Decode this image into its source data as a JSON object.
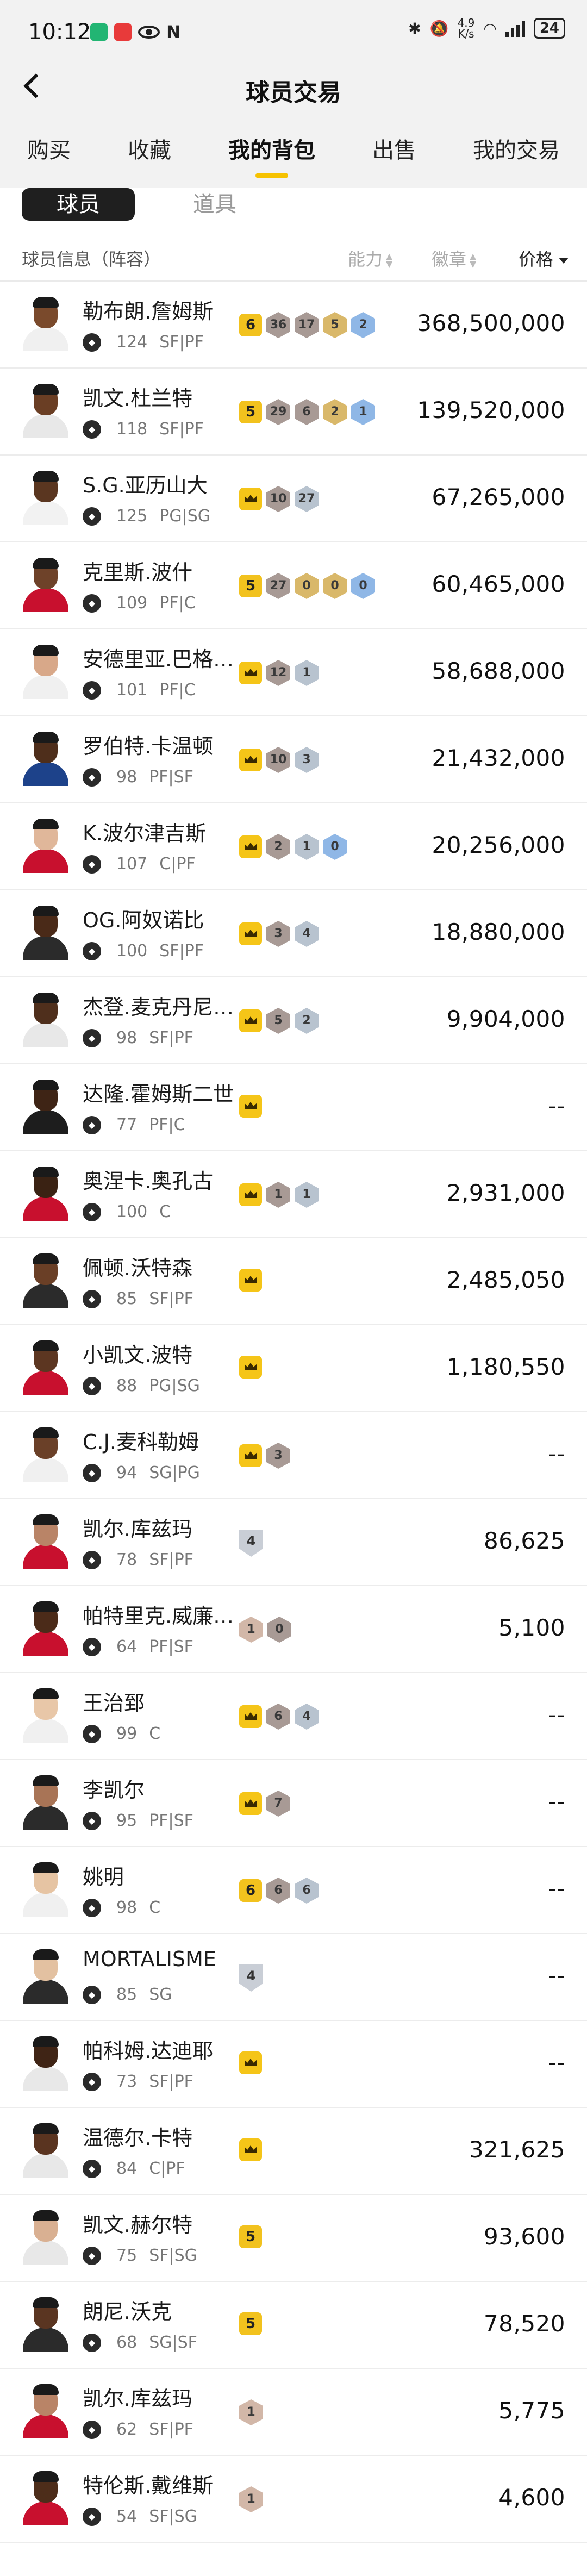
{
  "status_bar": {
    "time": "10:12",
    "speed_top": "4.9",
    "speed_bottom": "K/s",
    "battery": "24"
  },
  "nav": {
    "title": "球员交易"
  },
  "tabs": [
    {
      "label": "购买"
    },
    {
      "label": "收藏"
    },
    {
      "label": "我的背包"
    },
    {
      "label": "出售"
    },
    {
      "label": "我的交易"
    }
  ],
  "sub_tabs": {
    "players": "球员",
    "items": "道具"
  },
  "table_header": {
    "info": "球员信息（阵容）",
    "ability": "能力",
    "badge": "徽章",
    "price": "价格"
  },
  "colors": {
    "accent": "#f6c200",
    "crown": "#f5c518"
  },
  "players": [
    {
      "name": "勒布朗.詹姆斯",
      "rating": "124",
      "pos": "SF|PF",
      "skin": "#7a4a2c",
      "jersey": "#f0f0f0",
      "price": "368,500,000",
      "badges": [
        {
          "type": "lvl",
          "label": "6"
        },
        {
          "type": "hex",
          "color": "purple",
          "label": "36"
        },
        {
          "type": "hex",
          "color": "purple",
          "label": "17"
        },
        {
          "type": "hex",
          "color": "gold",
          "label": "5"
        },
        {
          "type": "hex",
          "color": "blue",
          "label": "2"
        }
      ]
    },
    {
      "name": "凯文.杜兰特",
      "rating": "118",
      "pos": "SF|PF",
      "skin": "#6a3e24",
      "jersey": "#e8e8e8",
      "price": "139,520,000",
      "badges": [
        {
          "type": "lvl",
          "label": "5"
        },
        {
          "type": "hex",
          "color": "purple",
          "label": "29"
        },
        {
          "type": "hex",
          "color": "purple",
          "label": "6"
        },
        {
          "type": "hex",
          "color": "gold",
          "label": "2"
        },
        {
          "type": "hex",
          "color": "blue",
          "label": "1"
        }
      ]
    },
    {
      "name": "S.G.亚历山大",
      "rating": "125",
      "pos": "PG|SG",
      "skin": "#5a3620",
      "jersey": "#f2f2f2",
      "price": "67,265,000",
      "badges": [
        {
          "type": "crown",
          "label": ""
        },
        {
          "type": "hex",
          "color": "purple",
          "label": "10"
        },
        {
          "type": "hex",
          "color": "silver",
          "label": "27"
        }
      ]
    },
    {
      "name": "克里斯.波什",
      "rating": "109",
      "pos": "PF|C",
      "skin": "#6e4229",
      "jersey": "#c8102e",
      "price": "60,465,000",
      "badges": [
        {
          "type": "lvl",
          "label": "5"
        },
        {
          "type": "hex",
          "color": "purple",
          "label": "27"
        },
        {
          "type": "hex",
          "color": "gold",
          "label": "0"
        },
        {
          "type": "hex",
          "color": "gold",
          "label": "0"
        },
        {
          "type": "hex",
          "color": "blue",
          "label": "0"
        }
      ]
    },
    {
      "name": "安德里亚.巴格纳尼",
      "rating": "101",
      "pos": "PF|C",
      "skin": "#d8a889",
      "jersey": "#f0f0f0",
      "price": "58,688,000",
      "badges": [
        {
          "type": "crown",
          "label": ""
        },
        {
          "type": "hex",
          "color": "purple",
          "label": "12"
        },
        {
          "type": "hex",
          "color": "silver",
          "label": "1"
        }
      ]
    },
    {
      "name": "罗伯特.卡温顿",
      "rating": "98",
      "pos": "PF|SF",
      "skin": "#4e2e1b",
      "jersey": "#1d428a",
      "price": "21,432,000",
      "badges": [
        {
          "type": "crown",
          "label": ""
        },
        {
          "type": "hex",
          "color": "purple",
          "label": "10"
        },
        {
          "type": "hex",
          "color": "silver",
          "label": "3"
        }
      ]
    },
    {
      "name": "K.波尔津吉斯",
      "rating": "107",
      "pos": "C|PF",
      "skin": "#e0b79a",
      "jersey": "#c8102e",
      "price": "20,256,000",
      "badges": [
        {
          "type": "crown",
          "label": ""
        },
        {
          "type": "hex",
          "color": "purple",
          "label": "2"
        },
        {
          "type": "hex",
          "color": "silver",
          "label": "1"
        },
        {
          "type": "hex",
          "color": "blue",
          "label": "0"
        }
      ]
    },
    {
      "name": "OG.阿奴诺比",
      "rating": "100",
      "pos": "SF|PF",
      "skin": "#4a2a18",
      "jersey": "#2b2b2b",
      "price": "18,880,000",
      "badges": [
        {
          "type": "crown",
          "label": ""
        },
        {
          "type": "hex",
          "color": "purple",
          "label": "3"
        },
        {
          "type": "hex",
          "color": "silver",
          "label": "4"
        }
      ]
    },
    {
      "name": "杰登.麦克丹尼尔斯",
      "rating": "98",
      "pos": "SF|PF",
      "skin": "#4f2f1c",
      "jersey": "#e8e8e8",
      "price": "9,904,000",
      "badges": [
        {
          "type": "crown",
          "label": ""
        },
        {
          "type": "hex",
          "color": "purple",
          "label": "5"
        },
        {
          "type": "hex",
          "color": "silver",
          "label": "2"
        }
      ]
    },
    {
      "name": "达隆.霍姆斯二世",
      "rating": "77",
      "pos": "PF|C",
      "skin": "#3e2415",
      "jersey": "#1d1d1d",
      "price": "--",
      "badges": [
        {
          "type": "crown",
          "label": ""
        }
      ]
    },
    {
      "name": "奥涅卡.奥孔古",
      "rating": "100",
      "pos": "C",
      "skin": "#3a2213",
      "jersey": "#c8102e",
      "price": "2,931,000",
      "badges": [
        {
          "type": "crown",
          "label": ""
        },
        {
          "type": "hex",
          "color": "purple",
          "label": "1"
        },
        {
          "type": "hex",
          "color": "silver",
          "label": "1"
        }
      ]
    },
    {
      "name": "佩顿.沃特森",
      "rating": "85",
      "pos": "SF|PF",
      "skin": "#6a3f26",
      "jersey": "#2b2b2b",
      "price": "2,485,050",
      "badges": [
        {
          "type": "crown",
          "label": ""
        }
      ]
    },
    {
      "name": "小凯文.波特",
      "rating": "88",
      "pos": "PG|SG",
      "skin": "#5c3621",
      "jersey": "#c8102e",
      "price": "1,180,550",
      "badges": [
        {
          "type": "crown",
          "label": ""
        }
      ]
    },
    {
      "name": "C.J.麦科勒姆",
      "rating": "94",
      "pos": "SG|PG",
      "skin": "#6a4028",
      "jersey": "#f0f0f0",
      "price": "--",
      "badges": [
        {
          "type": "crown",
          "label": ""
        },
        {
          "type": "hex",
          "color": "purple",
          "label": "3"
        }
      ]
    },
    {
      "name": "凯尔.库兹玛",
      "rating": "78",
      "pos": "SF|PF",
      "skin": "#b98467",
      "jersey": "#c8102e",
      "price": "86,625",
      "badges": [
        {
          "type": "shield",
          "label": "4"
        }
      ]
    },
    {
      "name": "帕特里克.威廉姆斯",
      "rating": "64",
      "pos": "PF|SF",
      "skin": "#4b2b19",
      "jersey": "#c8102e",
      "price": "5,100",
      "badges": [
        {
          "type": "hex",
          "color": "bronze",
          "label": "1"
        },
        {
          "type": "hex",
          "color": "purple",
          "label": "0"
        }
      ]
    },
    {
      "name": "王治郅",
      "rating": "99",
      "pos": "C",
      "skin": "#e8c7a8",
      "jersey": "#f0f0f0",
      "price": "--",
      "badges": [
        {
          "type": "crown",
          "label": ""
        },
        {
          "type": "hex",
          "color": "purple",
          "label": "6"
        },
        {
          "type": "hex",
          "color": "silver",
          "label": "4"
        }
      ]
    },
    {
      "name": "李凯尔",
      "rating": "95",
      "pos": "PF|SF",
      "skin": "#a87456",
      "jersey": "#2b2b2b",
      "price": "--",
      "badges": [
        {
          "type": "crown",
          "label": ""
        },
        {
          "type": "hex",
          "color": "purple",
          "label": "7"
        }
      ]
    },
    {
      "name": "姚明",
      "rating": "98",
      "pos": "C",
      "skin": "#e6c4a3",
      "jersey": "#f0f0f0",
      "price": "--",
      "badges": [
        {
          "type": "lvl",
          "label": "6"
        },
        {
          "type": "hex",
          "color": "purple",
          "label": "6"
        },
        {
          "type": "hex",
          "color": "silver",
          "label": "6"
        }
      ]
    },
    {
      "name": "MORTALISME",
      "rating": "85",
      "pos": "SG",
      "skin": "#e3c1a1",
      "jersey": "#2b2b2b",
      "price": "--",
      "badges": [
        {
          "type": "shield",
          "label": "4"
        }
      ]
    },
    {
      "name": "帕科姆.达迪耶",
      "rating": "73",
      "pos": "SF|PF",
      "skin": "#3f2415",
      "jersey": "#e8e8e8",
      "price": "--",
      "badges": [
        {
          "type": "crown",
          "label": ""
        }
      ]
    },
    {
      "name": "温德尔.卡特",
      "rating": "84",
      "pos": "C|PF",
      "skin": "#5a3420",
      "jersey": "#e8e8e8",
      "price": "321,625",
      "badges": [
        {
          "type": "crown",
          "label": ""
        }
      ]
    },
    {
      "name": "凯文.赫尔特",
      "rating": "75",
      "pos": "SF|SG",
      "skin": "#d9b092",
      "jersey": "#e8e8e8",
      "price": "93,600",
      "badges": [
        {
          "type": "lvl",
          "label": "5"
        }
      ]
    },
    {
      "name": "朗尼.沃克",
      "rating": "68",
      "pos": "SG|SF",
      "skin": "#5a3521",
      "jersey": "#2b2b2b",
      "price": "78,520",
      "badges": [
        {
          "type": "lvl",
          "label": "5"
        }
      ]
    },
    {
      "name": "凯尔.库兹玛",
      "rating": "62",
      "pos": "SF|PF",
      "skin": "#b98467",
      "jersey": "#c8102e",
      "price": "5,775",
      "badges": [
        {
          "type": "hex",
          "color": "bronze",
          "label": "1"
        }
      ]
    },
    {
      "name": "特伦斯.戴维斯",
      "rating": "54",
      "pos": "SF|SG",
      "skin": "#4d2d1a",
      "jersey": "#c8102e",
      "price": "4,600",
      "badges": [
        {
          "type": "hex",
          "color": "bronze",
          "label": "1"
        }
      ]
    }
  ]
}
